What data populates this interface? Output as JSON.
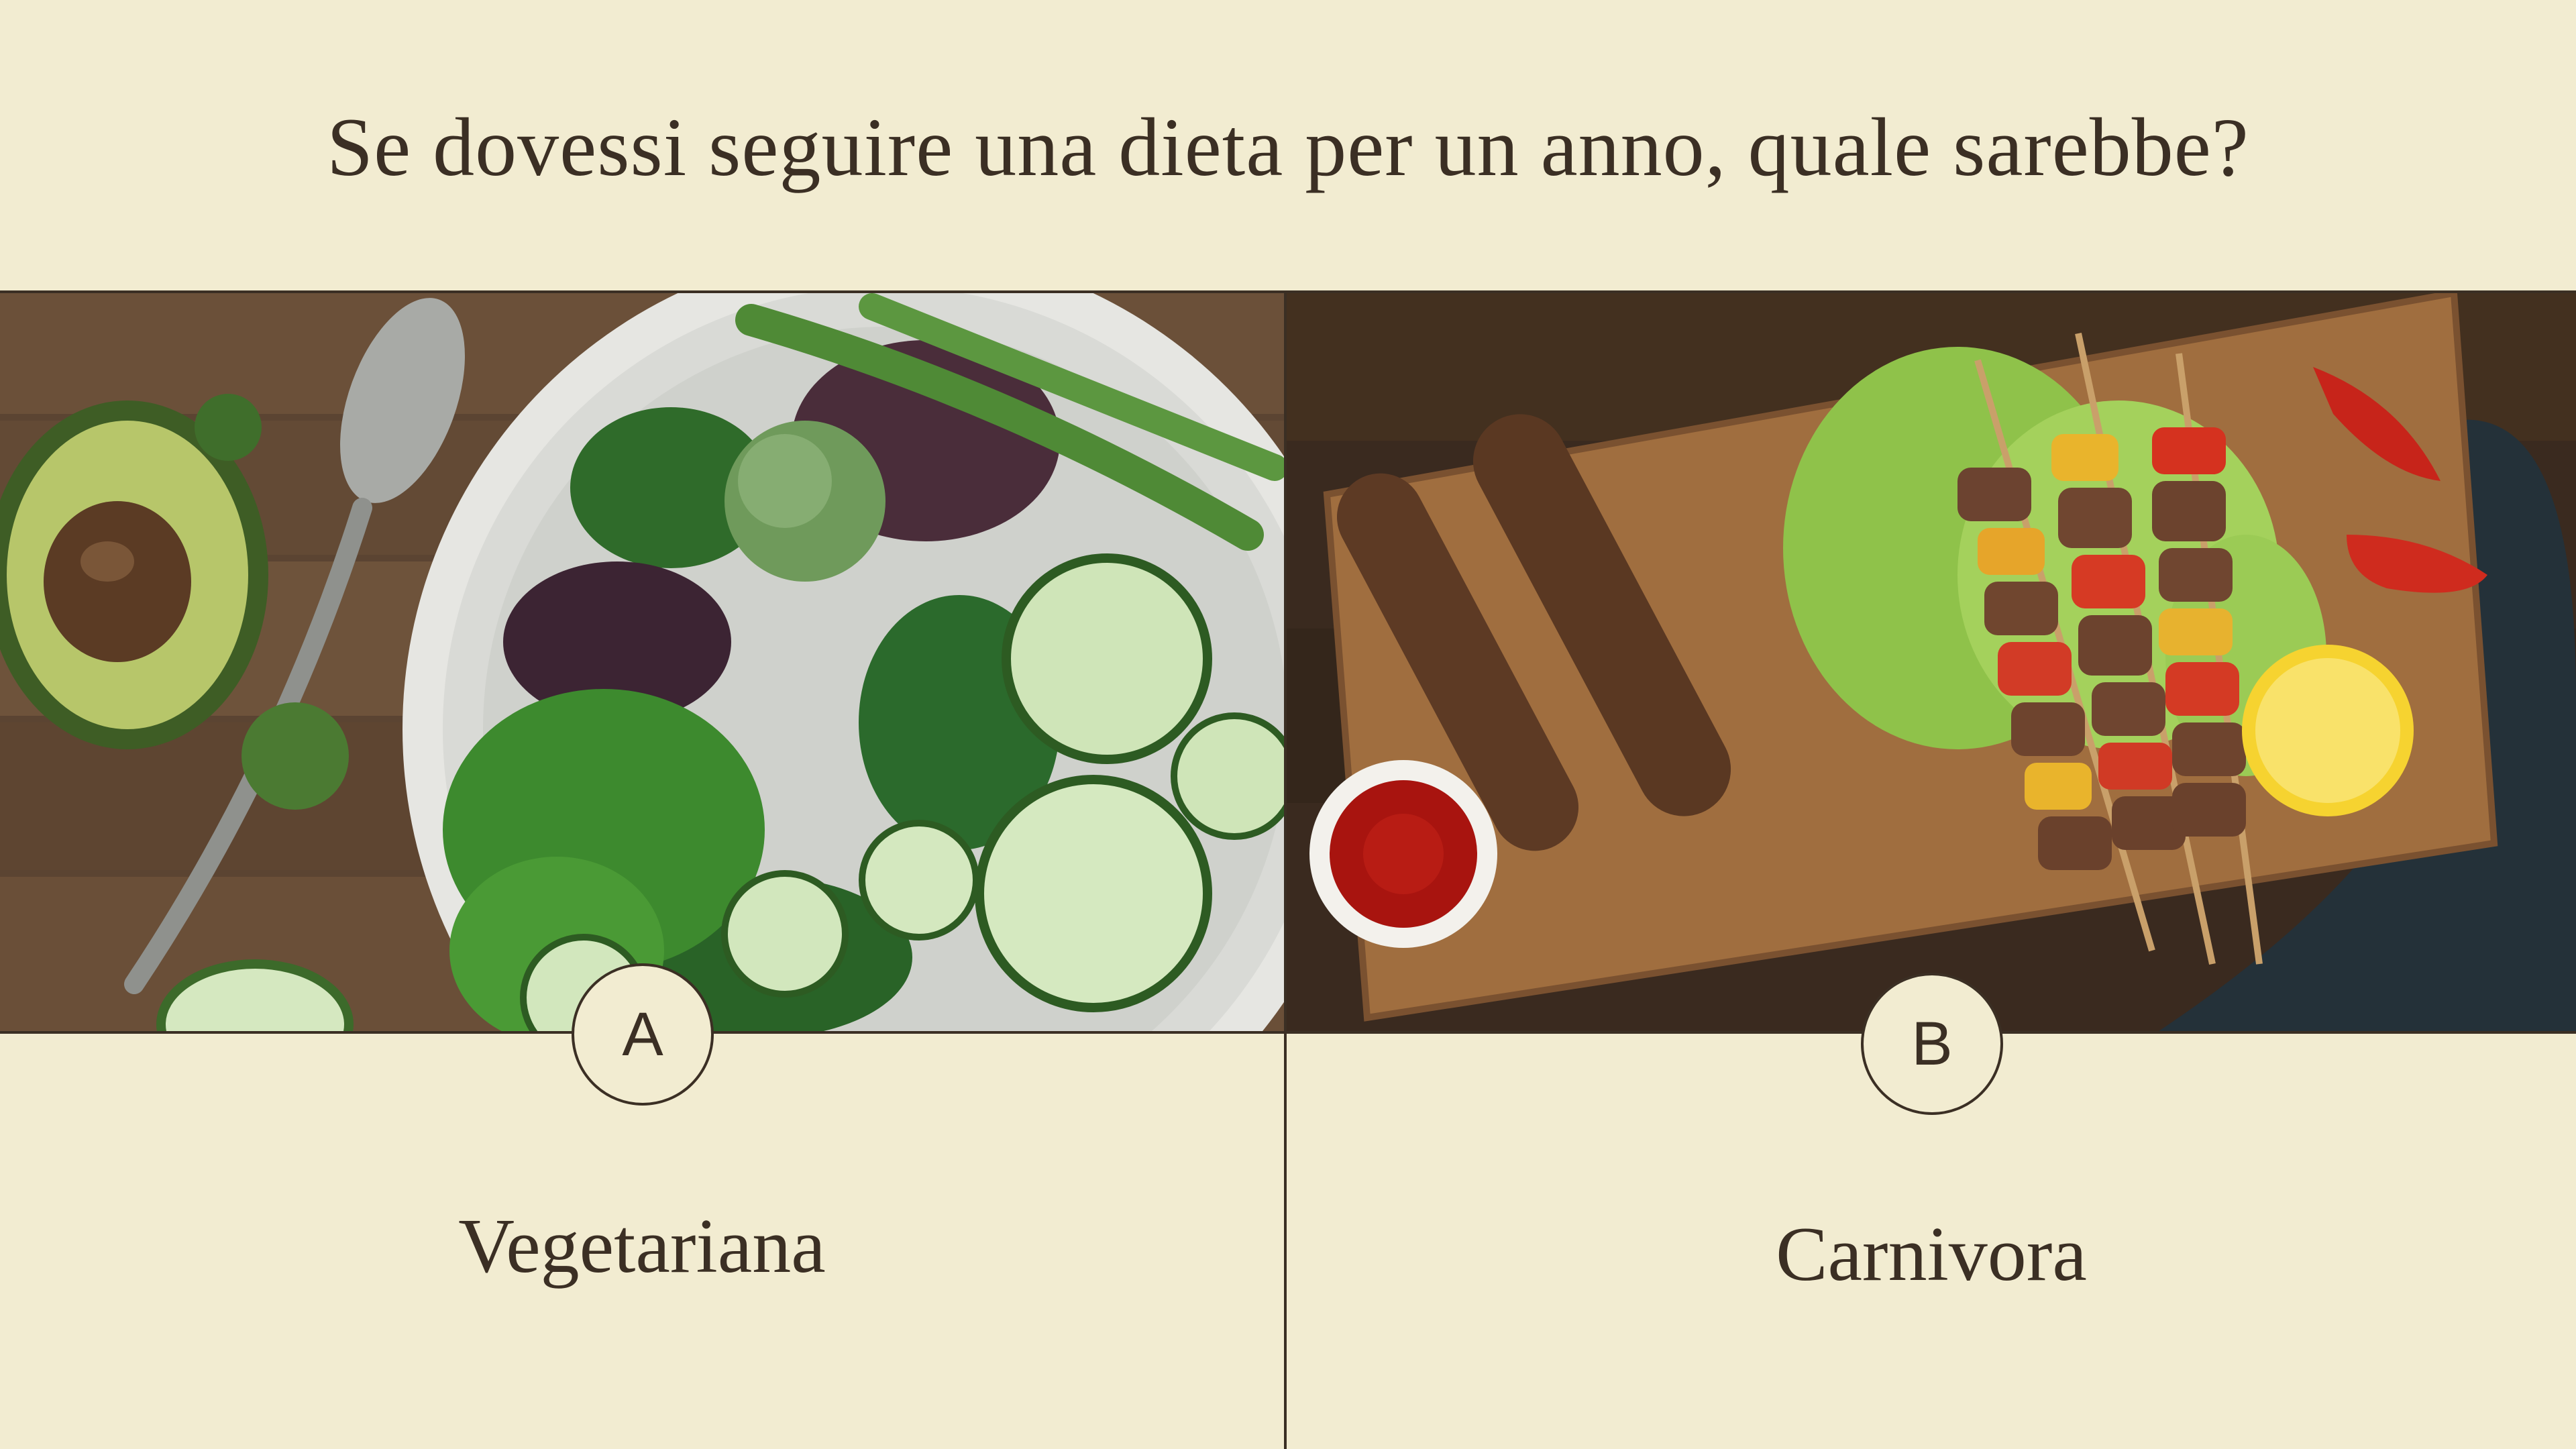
{
  "question": "Se dovessi seguire una dieta per un anno, quale sarebbe?",
  "options": [
    {
      "letter": "A",
      "label": "Vegetariana",
      "image": "vegetable-salad-photo"
    },
    {
      "letter": "B",
      "label": "Carnivora",
      "image": "grilled-meat-skewers-photo"
    }
  ],
  "colors": {
    "background": "#f2ecd1",
    "text": "#3b2f24",
    "line": "#3b2f24"
  }
}
